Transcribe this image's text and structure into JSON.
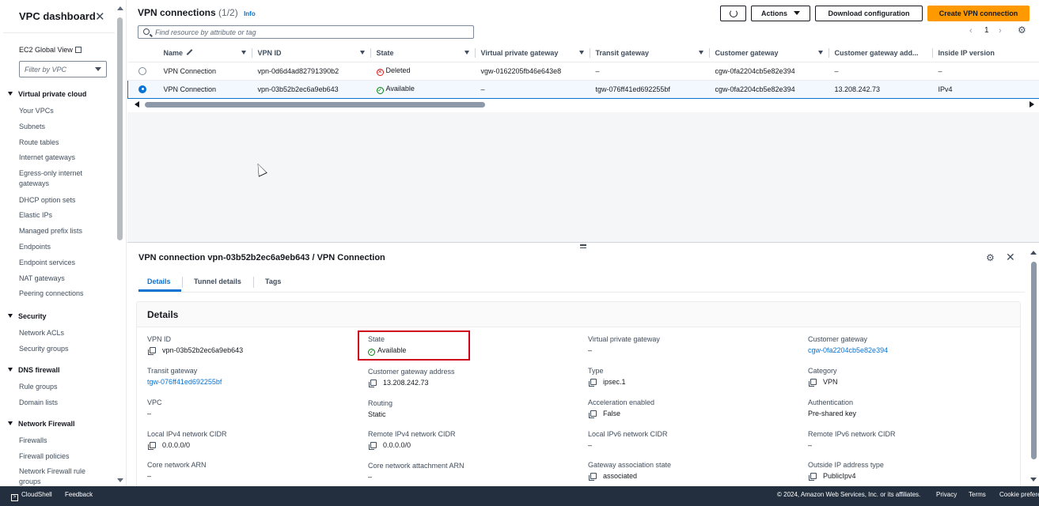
{
  "sidebar": {
    "title": "VPC dashboard",
    "ec2_global_view": "EC2 Global View",
    "filter_placeholder": "Filter by VPC",
    "sections": [
      {
        "label": "Virtual private cloud",
        "items": [
          "Your VPCs",
          "Subnets",
          "Route tables",
          "Internet gateways",
          "Egress-only internet gateways",
          "DHCP option sets",
          "Elastic IPs",
          "Managed prefix lists",
          "Endpoints",
          "Endpoint services",
          "NAT gateways",
          "Peering connections"
        ]
      },
      {
        "label": "Security",
        "items": [
          "Network ACLs",
          "Security groups"
        ]
      },
      {
        "label": "DNS firewall",
        "items": [
          "Rule groups",
          "Domain lists"
        ]
      },
      {
        "label": "Network Firewall",
        "items": [
          "Firewalls",
          "Firewall policies",
          "Network Firewall rule groups"
        ]
      }
    ]
  },
  "header": {
    "title": "VPN connections",
    "count": "(1/2)",
    "info": "Info",
    "actions_label": "Actions",
    "download_label": "Download configuration",
    "create_label": "Create VPN connection",
    "search_placeholder": "Find resource by attribute or tag",
    "page_number": "1"
  },
  "table": {
    "columns": [
      "Name",
      "VPN ID",
      "State",
      "Virtual private gateway",
      "Transit gateway",
      "Customer gateway",
      "Customer gateway add...",
      "Inside IP version"
    ],
    "rows": [
      {
        "selected": false,
        "name": "VPN Connection",
        "vpn_id": "vpn-0d6d4ad82791390b2",
        "state": "Deleted",
        "vgw": "vgw-0162205fb46e643e8",
        "tgw": "–",
        "cgw": "cgw-0fa2204cb5e82e394",
        "cgw_address": "–",
        "inside_ip": "–"
      },
      {
        "selected": true,
        "name": "VPN Connection",
        "vpn_id": "vpn-03b52b2ec6a9eb643",
        "state": "Available",
        "vgw": "–",
        "tgw": "tgw-076ff41ed692255bf",
        "cgw": "cgw-0fa2204cb5e82e394",
        "cgw_address": "13.208.242.73",
        "inside_ip": "IPv4"
      }
    ]
  },
  "detail": {
    "title": "VPN connection vpn-03b52b2ec6a9eb643 / VPN Connection",
    "tabs": [
      "Details",
      "Tunnel details",
      "Tags"
    ],
    "section_title": "Details",
    "fields": {
      "vpn_id": {
        "label": "VPN ID",
        "value": "vpn-03b52b2ec6a9eb643"
      },
      "state": {
        "label": "State",
        "value": "Available"
      },
      "vgw": {
        "label": "Virtual private gateway",
        "value": "–"
      },
      "cgw": {
        "label": "Customer gateway",
        "value": "cgw-0fa2204cb5e82e394"
      },
      "tgw": {
        "label": "Transit gateway",
        "value": "tgw-076ff41ed692255bf"
      },
      "cgw_address": {
        "label": "Customer gateway address",
        "value": "13.208.242.73"
      },
      "type": {
        "label": "Type",
        "value": "ipsec.1"
      },
      "category": {
        "label": "Category",
        "value": "VPN"
      },
      "vpc": {
        "label": "VPC",
        "value": "–"
      },
      "routing": {
        "label": "Routing",
        "value": "Static"
      },
      "acceleration": {
        "label": "Acceleration enabled",
        "value": "False"
      },
      "authentication": {
        "label": "Authentication",
        "value": "Pre-shared key"
      },
      "local_ipv4": {
        "label": "Local IPv4 network CIDR",
        "value": "0.0.0.0/0"
      },
      "remote_ipv4": {
        "label": "Remote IPv4 network CIDR",
        "value": "0.0.0.0/0"
      },
      "local_ipv6": {
        "label": "Local IPv6 network CIDR",
        "value": "–"
      },
      "remote_ipv6": {
        "label": "Remote IPv6 network CIDR",
        "value": "–"
      },
      "core_arn": {
        "label": "Core network ARN",
        "value": "–"
      },
      "core_attach_arn": {
        "label": "Core network attachment ARN",
        "value": "–"
      },
      "gw_assoc_state": {
        "label": "Gateway association state",
        "value": "associated"
      },
      "outside_ip_type": {
        "label": "Outside IP address type",
        "value": "PublicIpv4"
      }
    }
  },
  "footer": {
    "cloudshell": "CloudShell",
    "feedback": "Feedback",
    "copyright": "© 2024, Amazon Web Services, Inc. or its affiliates.",
    "privacy": "Privacy",
    "terms": "Terms",
    "cookie": "Cookie prefere"
  },
  "colors": {
    "accent": "#0972d3",
    "primary_button": "#ff9900",
    "available": "#037f0c",
    "deleted": "#d91515",
    "footer_bg": "#232f3e",
    "highlight": "#d0021b"
  }
}
